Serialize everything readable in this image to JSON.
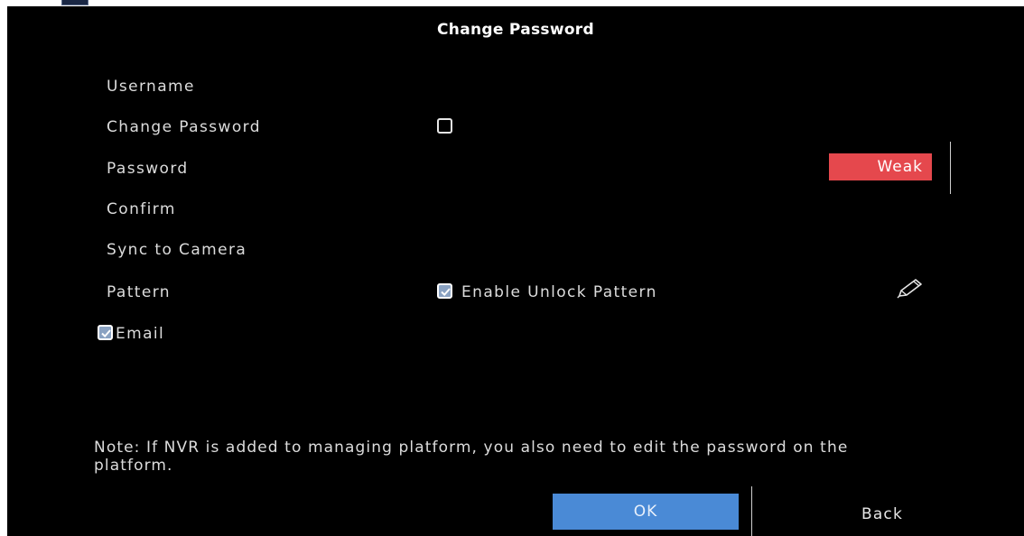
{
  "dialog": {
    "title": "Change Password"
  },
  "form": {
    "username_label": "Username",
    "change_password_label": "Change Password",
    "change_password_checked": false,
    "password_label": "Password",
    "strength_label": "Weak",
    "confirm_label": "Confirm",
    "sync_label": "Sync to Camera",
    "pattern_label": "Pattern",
    "enable_unlock_pattern_label": "Enable Unlock Pattern",
    "enable_unlock_pattern_checked": true,
    "email_label": "Email",
    "email_checked": true
  },
  "note": "Note: If NVR is added to managing platform, you also need to edit the password on the platform.",
  "buttons": {
    "ok_label": "OK",
    "back_label": "Back"
  },
  "colors": {
    "background": "#000000",
    "strength_weak": "#e5484d",
    "primary_button": "#4a8ad6",
    "checkbox_fill": "#8aa2c2"
  },
  "icons": {
    "edit_pattern": "pencil-icon",
    "checkmark": "checkmark-icon"
  }
}
